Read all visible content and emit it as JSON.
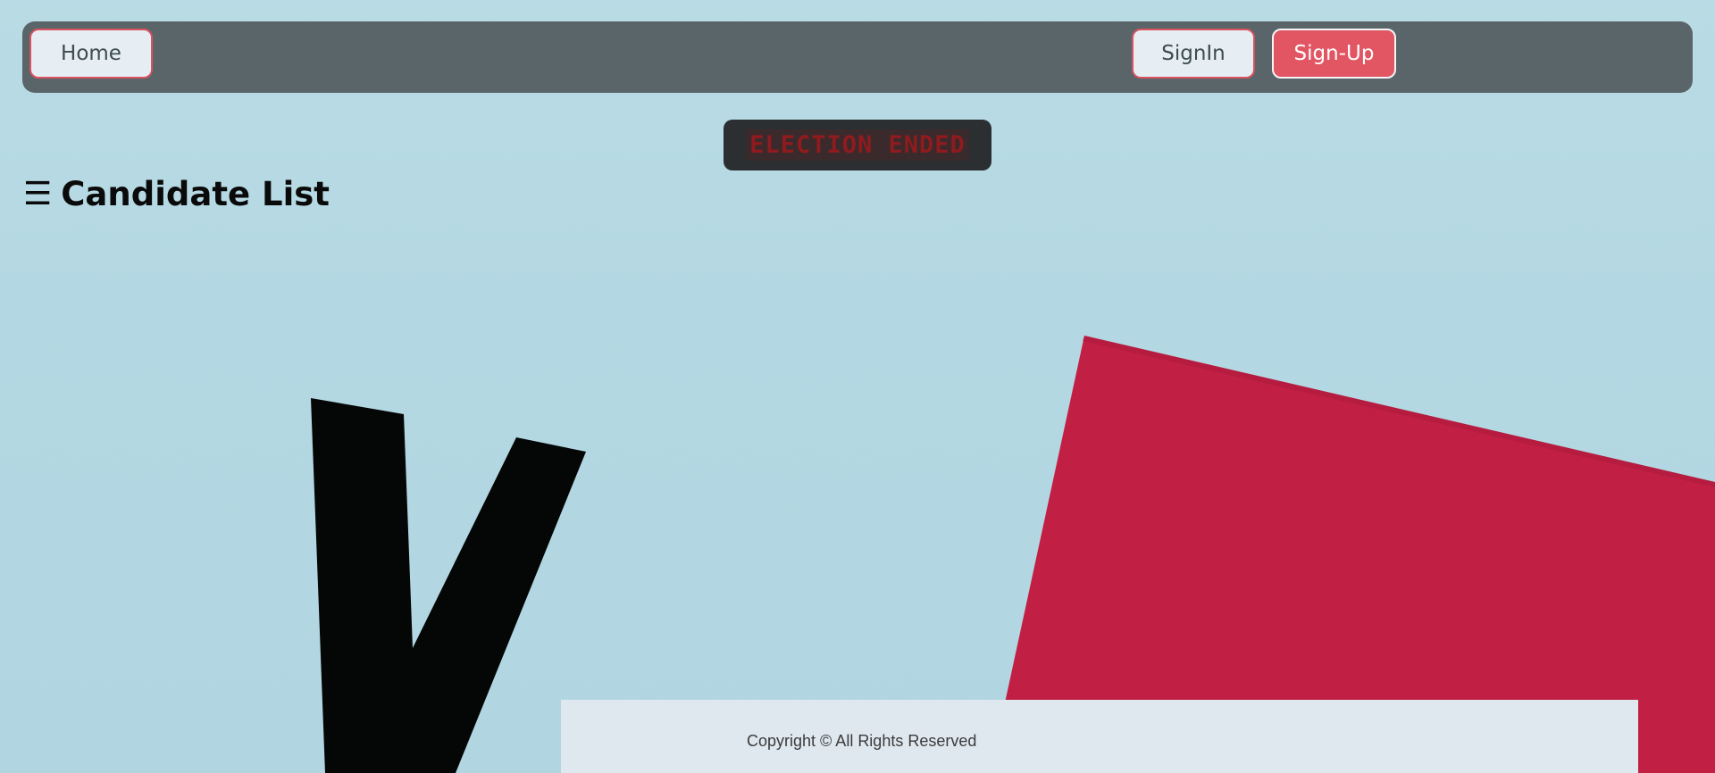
{
  "nav": {
    "home_label": "Home",
    "signin_label": "SignIn",
    "signup_label": "Sign-Up"
  },
  "badge": {
    "text": "ELECTION ENDED"
  },
  "page": {
    "menu_icon": "☰",
    "title": "Candidate List"
  },
  "footer": {
    "text": "Copyright © All Rights Reserved"
  },
  "colors": {
    "background": "#b4d8e3",
    "navbar": "#5a6569",
    "accent": "#e25663",
    "badge_bg": "#2c2f31",
    "badge_text": "#8f1b1f",
    "red_paper": "#c21f44"
  }
}
